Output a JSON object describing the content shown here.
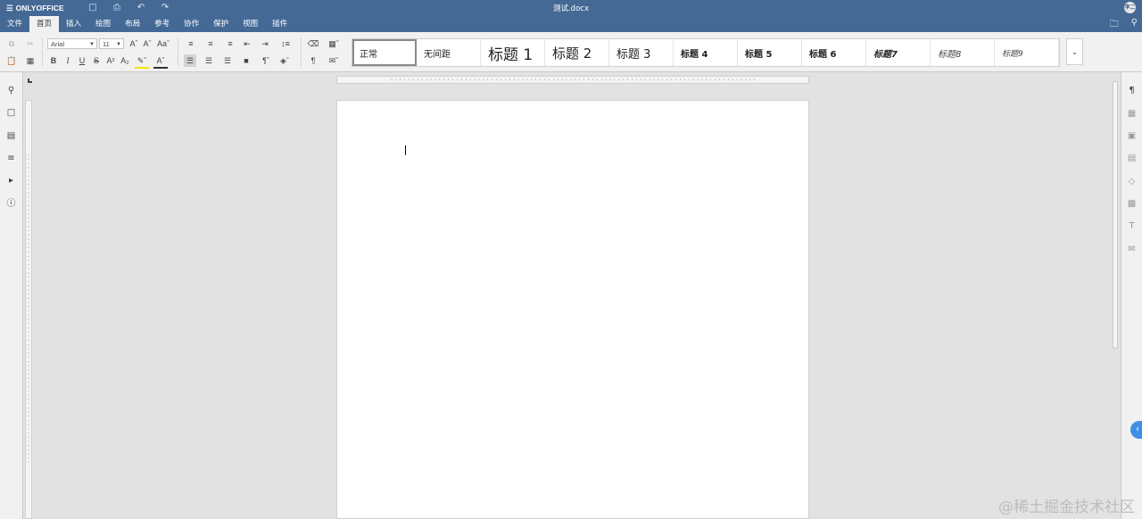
{
  "app": {
    "name": "ONLYOFFICE",
    "document_title": "测试.docx",
    "user_initials": "李二"
  },
  "menu": {
    "tabs": [
      "文件",
      "首页",
      "插入",
      "绘图",
      "布局",
      "参考",
      "协作",
      "保护",
      "视图",
      "插件"
    ],
    "active_index": 1
  },
  "toolbar": {
    "font_name": "Arial",
    "font_size": "11"
  },
  "styles": [
    "正常",
    "无间距",
    "标题 1",
    "标题 2",
    "标题 3",
    "标题 4",
    "标题 5",
    "标题 6",
    "标题7",
    "标题8",
    "标题9"
  ],
  "watermark": "@稀土掘金技术社区",
  "icons": {
    "title": [
      "save-icon",
      "print-icon",
      "undo-icon",
      "redo-icon"
    ],
    "left_panel": [
      "search-icon",
      "comments-icon",
      "chat-icon",
      "navigation-icon",
      "feedback-icon",
      "about-icon"
    ],
    "right_panel": [
      "paragraph-settings-icon",
      "table-settings-icon",
      "image-settings-icon",
      "header-footer-icon",
      "shape-settings-icon",
      "chart-settings-icon",
      "text-art-icon",
      "mail-merge-icon"
    ]
  }
}
